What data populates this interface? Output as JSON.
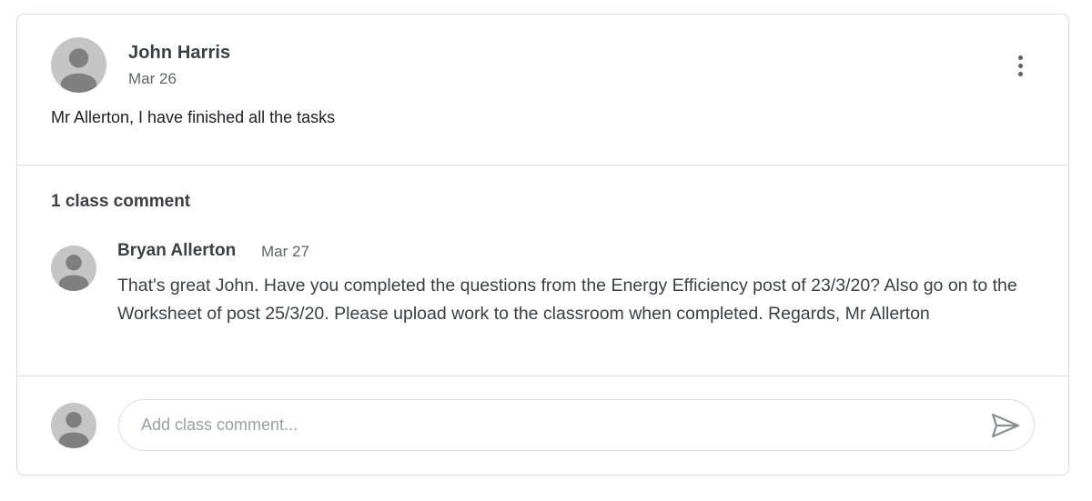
{
  "post": {
    "author": "John Harris",
    "date": "Mar 26",
    "body": "Mr Allerton, I have finished all the tasks",
    "avatar_icon": "person-avatar-icon",
    "menu_icon": "more-vertical-icon"
  },
  "comments": {
    "header": "1 class comment",
    "items": [
      {
        "author": "Bryan Allerton",
        "date": "Mar 27",
        "text": "That's great John. Have you completed the questions from the Energy Efficiency post of 23/3/20? Also go on to the Worksheet of post 25/3/20. Please upload work to the classroom when completed. Regards, Mr Allerton"
      }
    ]
  },
  "new_comment": {
    "placeholder": "Add class comment...",
    "value": "",
    "send_icon": "send-icon"
  },
  "colors": {
    "avatar": "#c5c5c5",
    "avatar_figure": "#7f7f7f",
    "border": "#dadce0",
    "secondary_text": "#5f6368"
  }
}
